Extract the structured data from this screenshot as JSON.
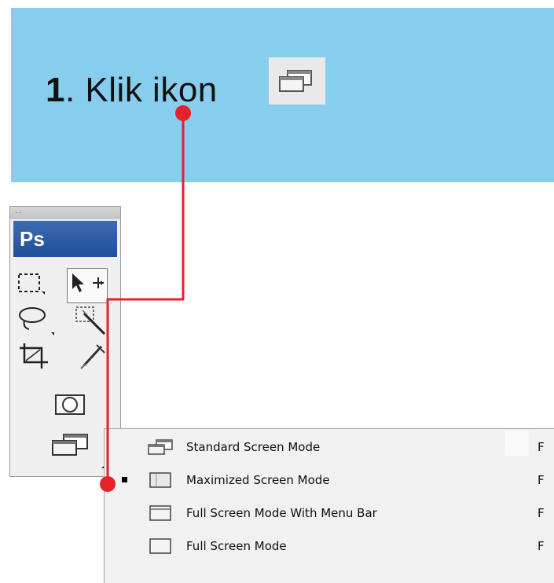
{
  "instruction": {
    "step_number": "1",
    "text": ". Klik ikon",
    "icon": "screen-mode-icon"
  },
  "tools_panel": {
    "logo": "Ps",
    "grip": "··",
    "tools": [
      "marquee-tool-icon",
      "move-tool-icon",
      "lasso-tool-icon",
      "magic-wand-tool-icon",
      "crop-tool-icon",
      "eyedropper-tool-icon",
      "quick-mask-icon",
      "screen-mode-icon"
    ]
  },
  "screen_mode_menu": {
    "items": [
      {
        "label": "Standard Screen Mode",
        "shortcut": "F",
        "icon": "standard-screen-mode-icon",
        "selected": false
      },
      {
        "label": "Maximized Screen Mode",
        "shortcut": "F",
        "icon": "maximized-screen-mode-icon",
        "selected": true
      },
      {
        "label": "Full Screen Mode With Menu Bar",
        "shortcut": "F",
        "icon": "full-screen-menu-bar-icon",
        "selected": false
      },
      {
        "label": "Full Screen Mode",
        "shortcut": "F",
        "icon": "full-screen-mode-icon",
        "selected": false
      }
    ]
  },
  "colors": {
    "banner": "#87ceee",
    "pointer": "#e8202a",
    "ps_logo": "#2a5aa3",
    "menu_bg": "#f1f1f1"
  }
}
